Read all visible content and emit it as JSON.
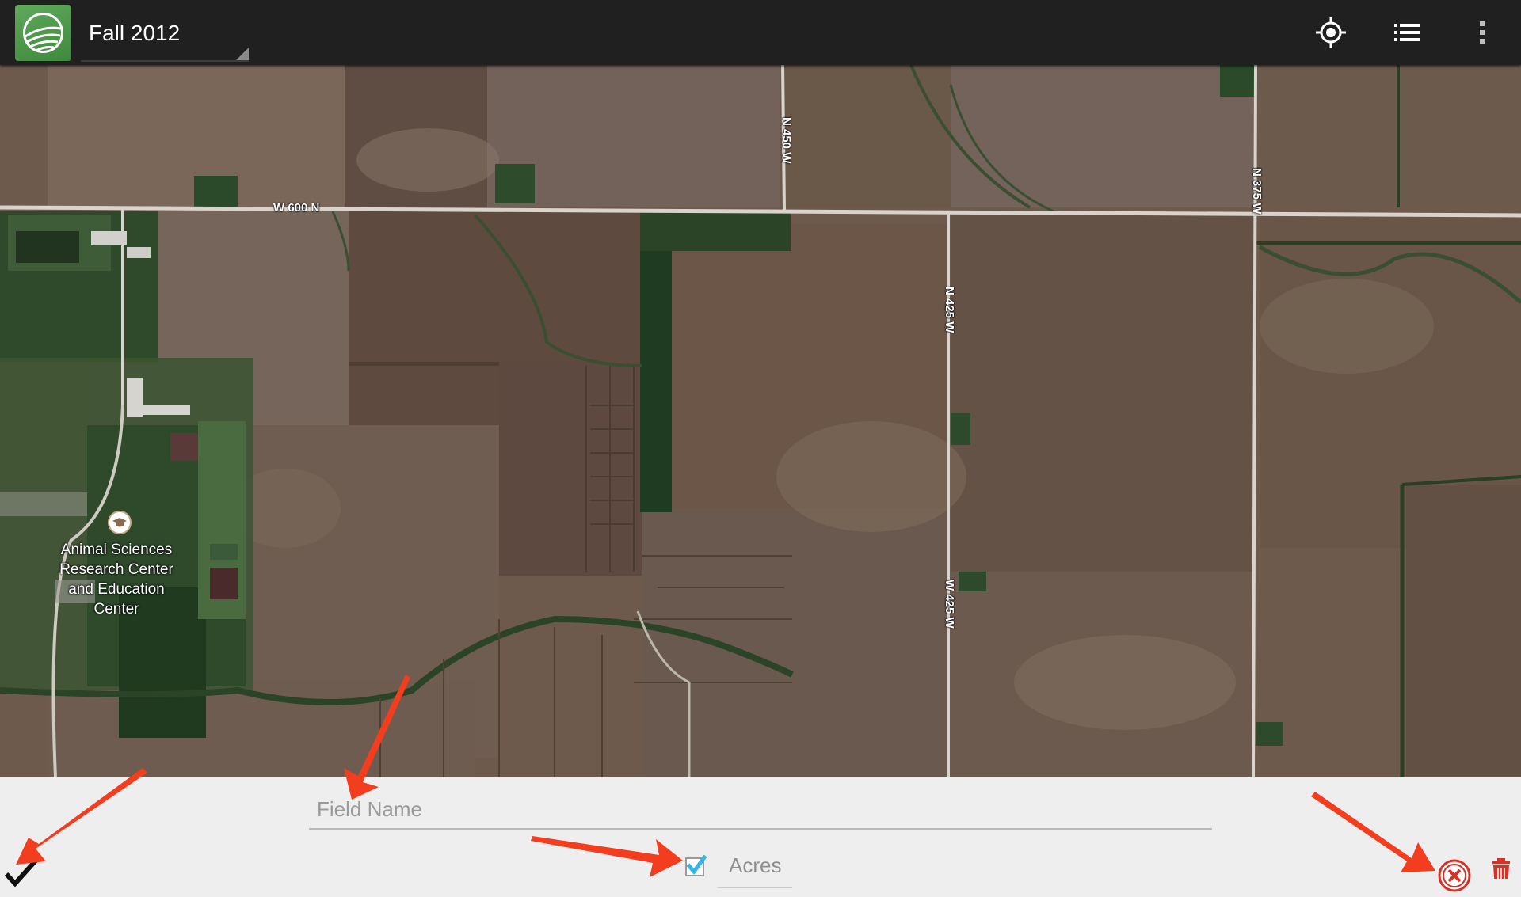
{
  "actionbar": {
    "logo_icon": "farm-field-logo-icon",
    "season_title": "Fall 2012",
    "locate_icon": "my-location-icon",
    "list_icon": "list-icon",
    "overflow_icon": "overflow-menu-icon"
  },
  "map": {
    "roads": {
      "w600n": "W 600 N",
      "n450w": "N 450 W",
      "n425w": "N 425 W",
      "w425w": "W 425 W",
      "n375w": "N 375 W"
    },
    "place_label": "Animal Sciences Research Center and Education Center",
    "place_icon": "school-cap-icon"
  },
  "panel": {
    "field_name_placeholder": "Field Name",
    "acres_label": "Acres",
    "acres_checked": true,
    "confirm_icon": "checkmark-icon",
    "cancel_icon": "cancel-circle-icon",
    "delete_icon": "trash-icon"
  },
  "colors": {
    "actionbar_bg": "#202020",
    "logo_green": "#4c9a4a",
    "checkbox_blue": "#33b5e5",
    "cancel_red": "#d93025",
    "annotation_arrow": "#f23d1e"
  }
}
